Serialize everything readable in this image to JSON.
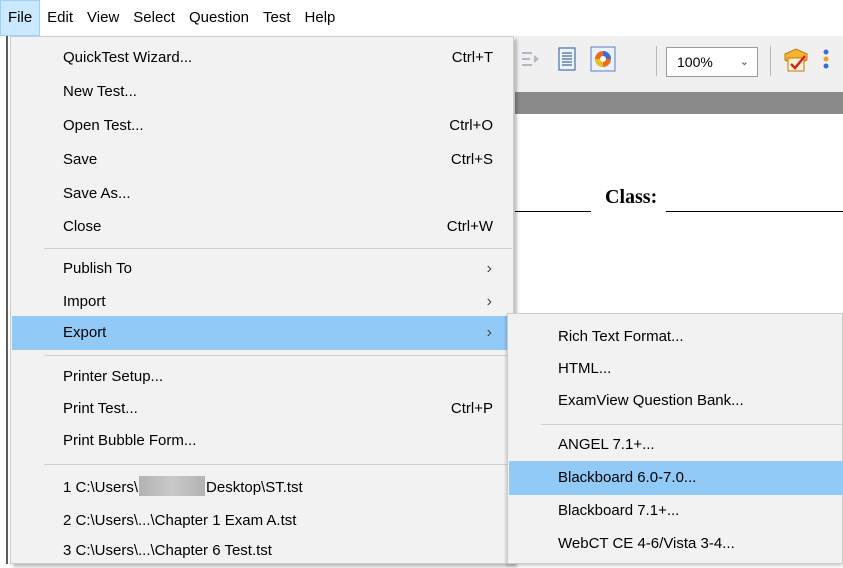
{
  "menubar": {
    "items": [
      {
        "label": "File",
        "active": true
      },
      {
        "label": "Edit"
      },
      {
        "label": "View"
      },
      {
        "label": "Select"
      },
      {
        "label": "Question"
      },
      {
        "label": "Test"
      },
      {
        "label": "Help"
      }
    ]
  },
  "toolbar": {
    "zoom_value": "100%"
  },
  "document": {
    "class_label": "Class:"
  },
  "file_menu": {
    "items": [
      {
        "label": "QuickTest Wizard...",
        "shortcut": "Ctrl+T"
      },
      {
        "label": "New Test..."
      },
      {
        "label": "Open Test...",
        "shortcut": "Ctrl+O"
      },
      {
        "label": "Save",
        "shortcut": "Ctrl+S"
      },
      {
        "label": "Save As..."
      },
      {
        "label": "Close",
        "shortcut": "Ctrl+W"
      },
      {
        "label": "Publish To"
      },
      {
        "label": "Import"
      },
      {
        "label": "Export"
      },
      {
        "label": "Printer Setup..."
      },
      {
        "label": "Print Test...",
        "shortcut": "Ctrl+P"
      },
      {
        "label": "Print Bubble Form..."
      },
      {
        "label_prefix": "1 C:\\Users\\",
        "label_suffix": "Desktop\\ST.tst"
      },
      {
        "label": "2 C:\\Users\\...\\Chapter 1 Exam A.tst"
      },
      {
        "label": "3 C:\\Users\\...\\Chapter 6 Test.tst"
      }
    ]
  },
  "export_submenu": {
    "items": [
      {
        "label": "Rich Text Format..."
      },
      {
        "label": "HTML..."
      },
      {
        "label": "ExamView Question Bank..."
      },
      {
        "label": "ANGEL 7.1+..."
      },
      {
        "label": "Blackboard 6.0-7.0..."
      },
      {
        "label": "Blackboard 7.1+..."
      },
      {
        "label": "WebCT CE 4-6/Vista 3-4..."
      }
    ]
  },
  "colors": {
    "highlight": "#91c9f7",
    "menu_bg": "#f2f2f2",
    "menubar_active": "#cce8ff"
  }
}
